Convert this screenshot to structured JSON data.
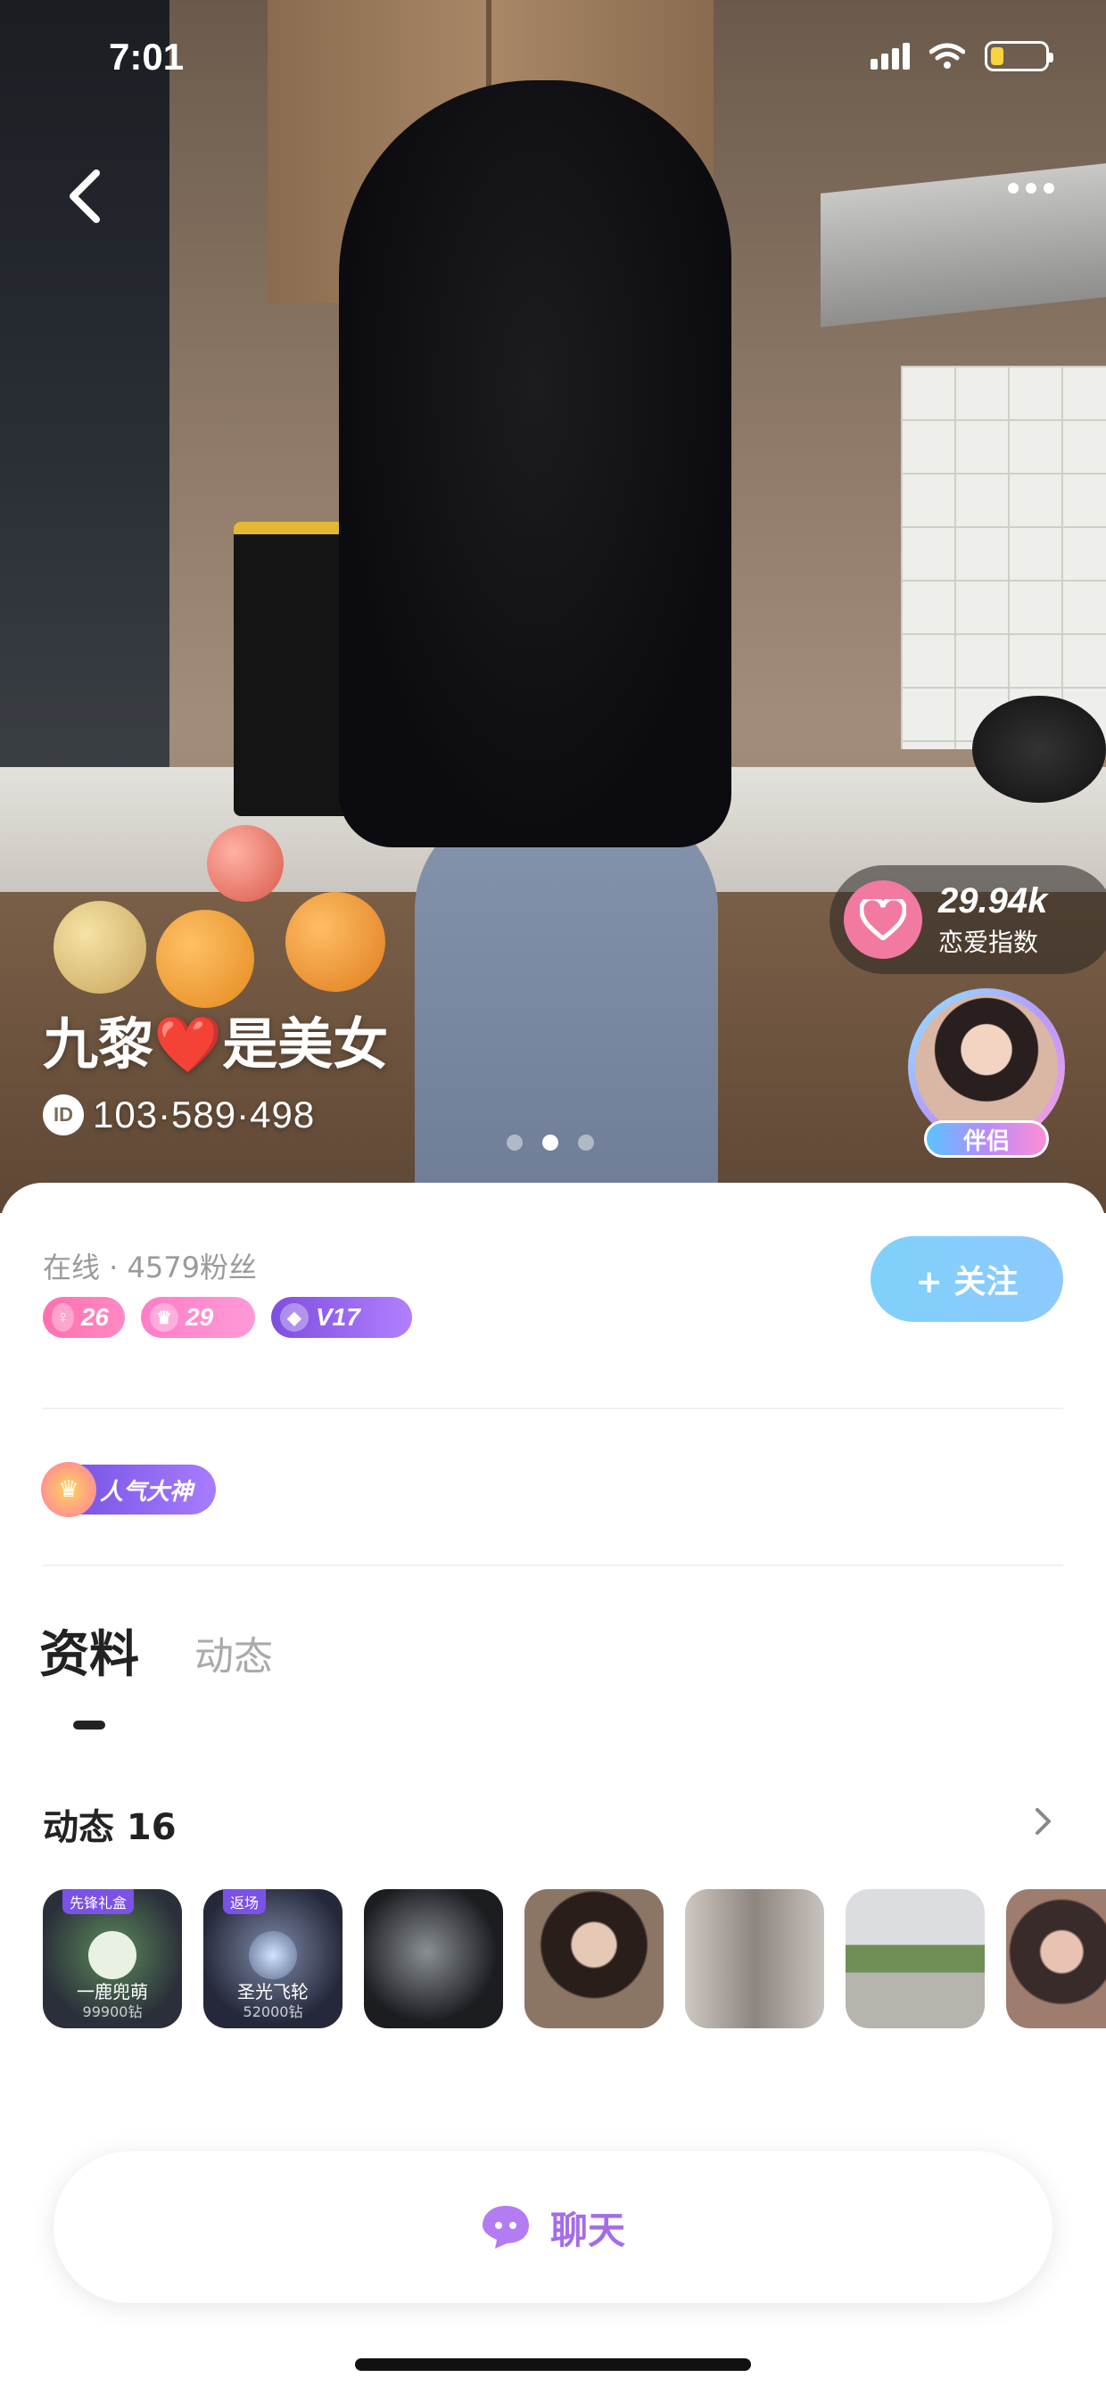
{
  "status_bar": {
    "time": "7:01"
  },
  "profile": {
    "name": "九黎❤️是美女",
    "id_label": "ID",
    "id_value": "103·589·498",
    "love_index_value": "29.94k",
    "love_index_label": "恋爱指数",
    "partner_tag": "伴侣",
    "photo_pages": 3,
    "photo_active_index": 2
  },
  "info": {
    "meta": "在线 · 4579粉丝",
    "badges": [
      {
        "icon": "female-icon",
        "label": "26",
        "color": "#ff6fae"
      },
      {
        "icon": "crown-level-icon",
        "label": "29",
        "color": "#ff8ac8"
      },
      {
        "icon": "vip-icon",
        "label": "V17",
        "color": "#8d5cf0"
      }
    ],
    "follow_label": "+ 关注",
    "honor_badge": "人气大神"
  },
  "tabs": [
    {
      "label": "资料",
      "active": true
    },
    {
      "label": "动态",
      "active": false
    }
  ],
  "moments": {
    "title": "动态 16",
    "thumbnails": [
      {
        "flag": "先锋礼盒",
        "caption": "一鹿兜萌",
        "sub": "99900钻"
      },
      {
        "flag": "返场",
        "caption": "圣光飞轮",
        "sub": "52000钻"
      },
      {
        "flag": "",
        "caption": "",
        "sub": ""
      },
      {
        "flag": "",
        "caption": "",
        "sub": ""
      },
      {
        "flag": "",
        "caption": "",
        "sub": ""
      },
      {
        "flag": "",
        "caption": "",
        "sub": ""
      },
      {
        "flag": "",
        "caption": "",
        "sub": ""
      }
    ]
  },
  "chat": {
    "label": "聊天"
  },
  "colors": {
    "accent": "#a56ce8",
    "follow": "#8ec9ff",
    "love": "#f27aa0"
  }
}
